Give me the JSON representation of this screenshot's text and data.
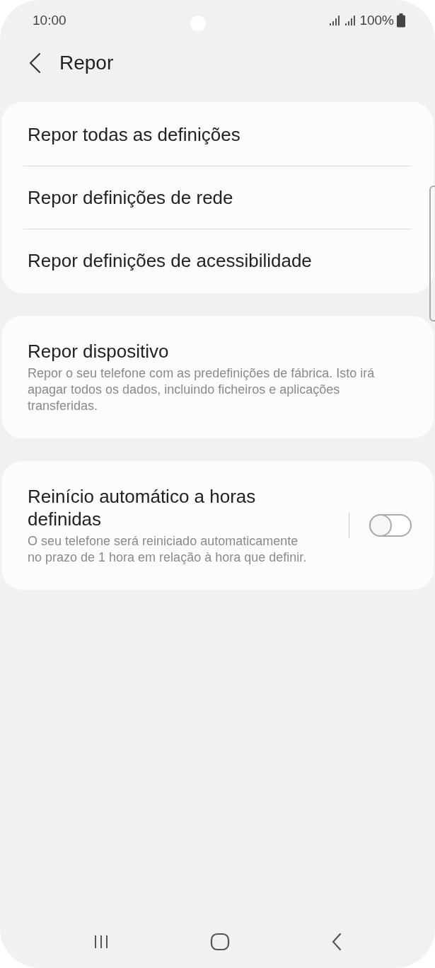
{
  "status_bar": {
    "time": "10:00",
    "battery": "100%"
  },
  "header": {
    "title": "Repor"
  },
  "groups": [
    {
      "items": [
        {
          "kind": "link",
          "title": "Repor todas as definições"
        },
        {
          "kind": "link",
          "title": "Repor definições de rede"
        },
        {
          "kind": "link",
          "title": "Repor definições de acessibilidade"
        }
      ]
    },
    {
      "items": [
        {
          "kind": "link",
          "title": "Repor dispositivo",
          "description": "Repor o seu telefone com as predefinições de fábrica. Isto irá apagar todos os dados, incluindo ficheiros e aplicações transferidas."
        }
      ]
    },
    {
      "items": [
        {
          "kind": "switch",
          "title": "Reinício automático a horas definidas",
          "description": "O seu telefone será reiniciado automaticamente no prazo de 1 hora em relação à hora que definir.",
          "on": false
        }
      ]
    }
  ]
}
